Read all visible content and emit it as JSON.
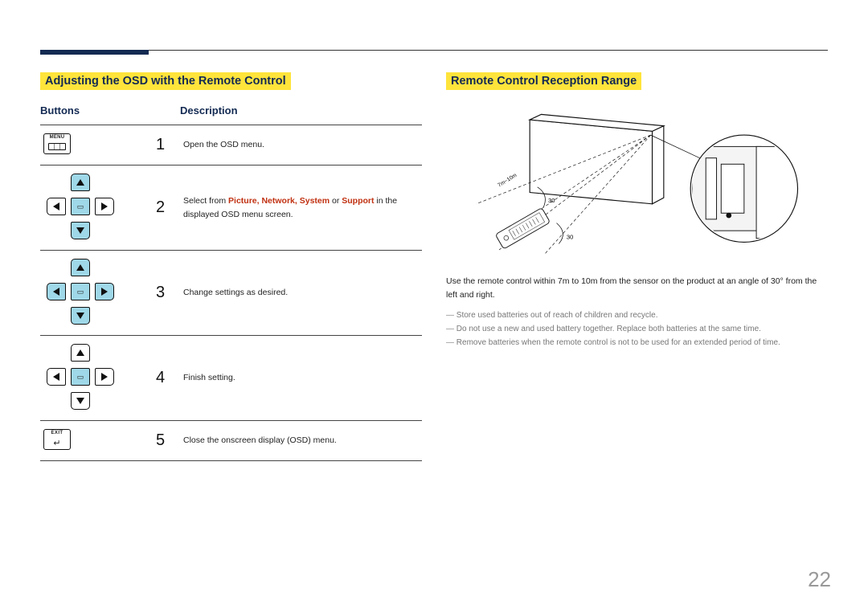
{
  "page_number": "22",
  "left": {
    "title": "Adjusting the OSD with the Remote Control",
    "headers": {
      "buttons": "Buttons",
      "description": "Description"
    },
    "rows": [
      {
        "num": "1",
        "desc_pre": "Open the OSD menu.",
        "desc_hl": "",
        "desc_post": ""
      },
      {
        "num": "2",
        "desc_pre": "Select from ",
        "desc_hl": "Picture, Network, System",
        "desc_mid": " or ",
        "desc_hl2": "Support",
        "desc_post": " in the displayed OSD menu screen."
      },
      {
        "num": "3",
        "desc_pre": "Change settings as desired.",
        "desc_hl": "",
        "desc_post": ""
      },
      {
        "num": "4",
        "desc_pre": "Finish setting.",
        "desc_hl": "",
        "desc_post": ""
      },
      {
        "num": "5",
        "desc_pre": "Close the onscreen display (OSD) menu.",
        "desc_hl": "",
        "desc_post": ""
      }
    ]
  },
  "right": {
    "title": "Remote Control Reception Range",
    "diagram": {
      "distance_label": "7m~10m",
      "angle_label": "30"
    },
    "paragraph": "Use the remote control within 7m to 10m from the sensor on the product at an angle of 30° from the left and right.",
    "bullets": [
      "Store used batteries out of reach of children and recycle.",
      "Do not use a new and used battery together. Replace both batteries at the same time.",
      "Remove batteries when the remote control is not to be used for an extended period of time."
    ]
  }
}
